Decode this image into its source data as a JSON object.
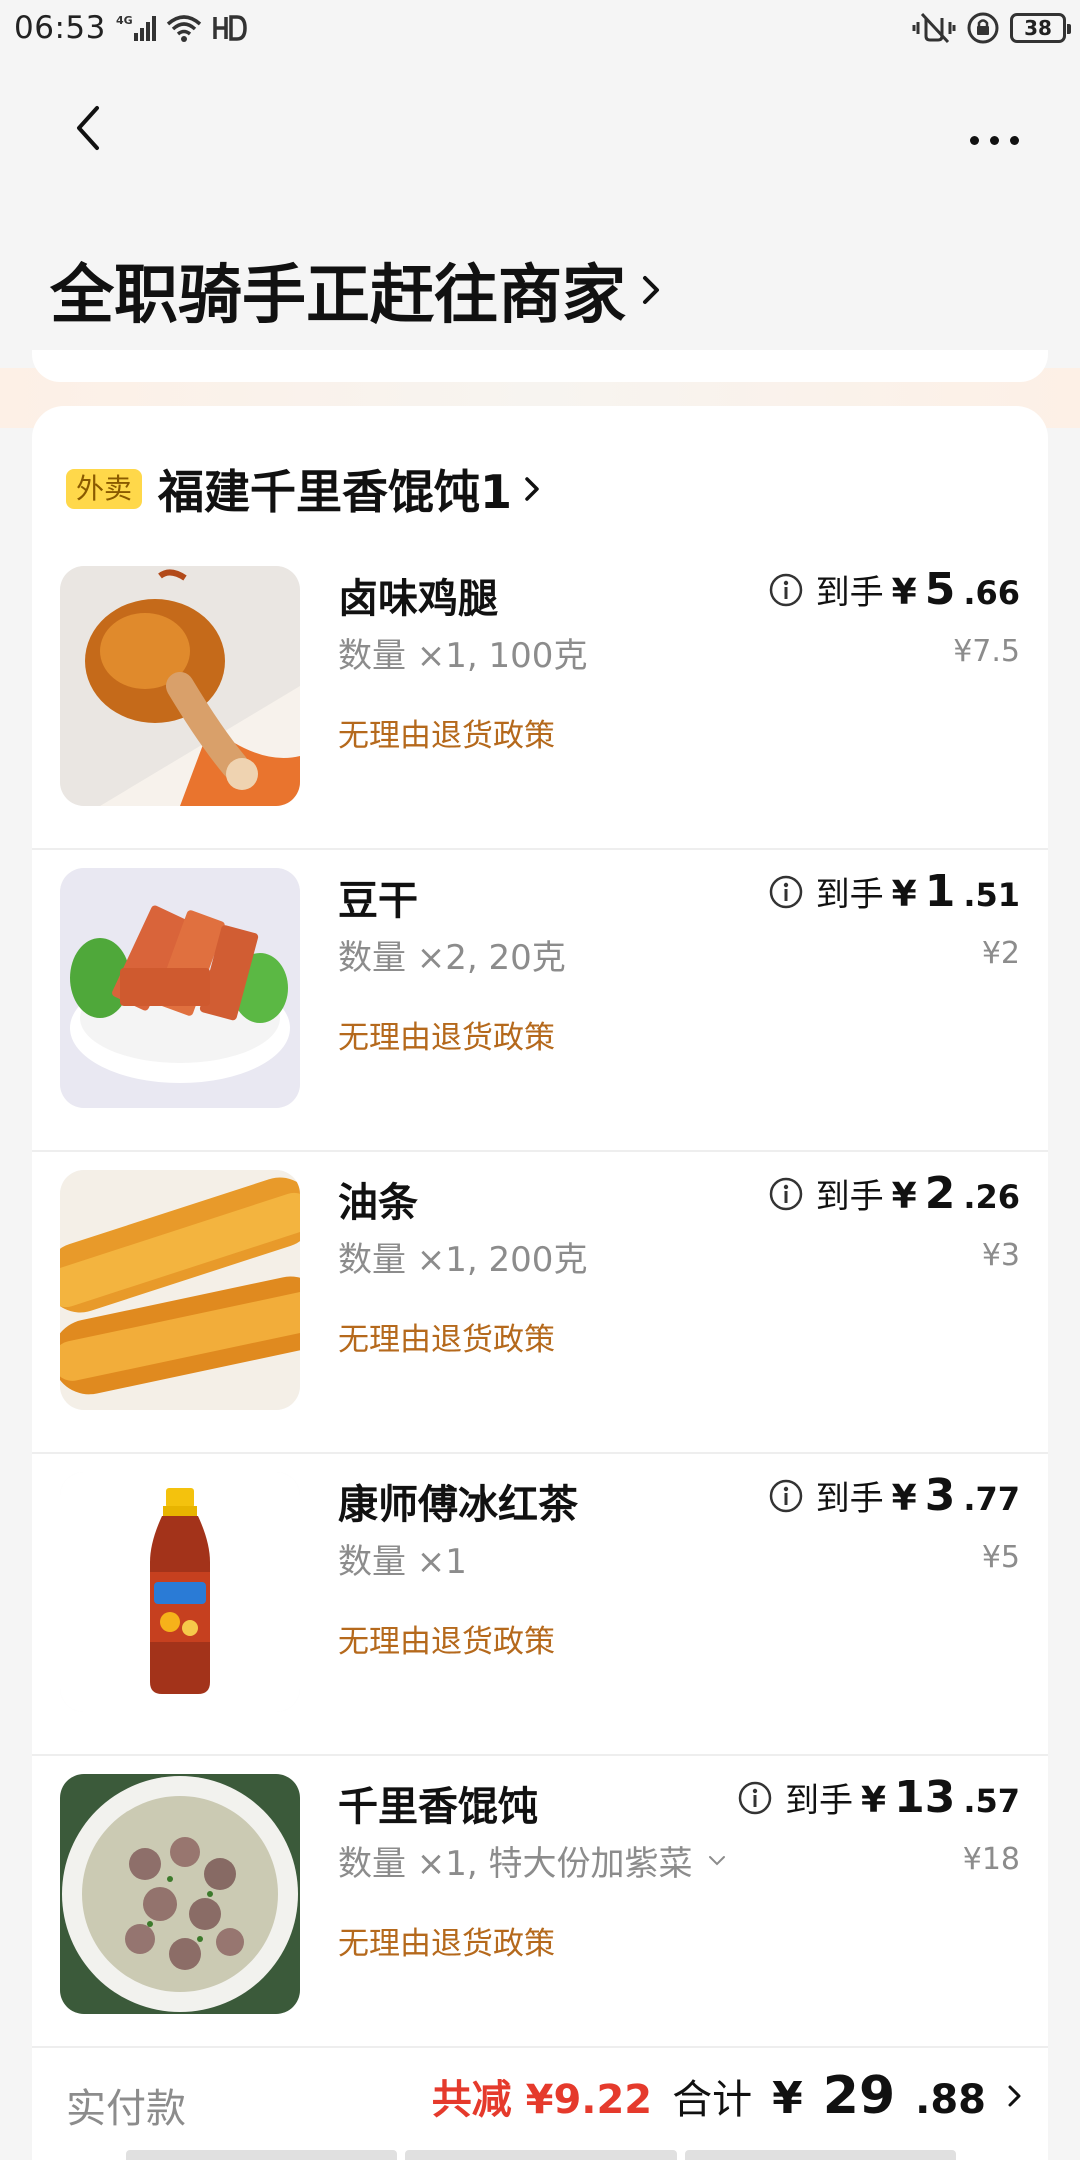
{
  "status_bar": {
    "time": "06:53",
    "network": "4G",
    "hd": "HD",
    "battery": "38"
  },
  "header": {
    "title": "全职骑手正赶往商家"
  },
  "store": {
    "tag": "外卖",
    "name": "福建千里香馄饨1"
  },
  "items": [
    {
      "name": "卤味鸡腿",
      "qty": "数量 ×1, 100克",
      "policy": "无理由退货政策",
      "price_prefix": "到手",
      "price_yen": "¥",
      "price_int": "5",
      "price_dec": ".66",
      "orig_price": "¥7.5",
      "image": "chicken-leg"
    },
    {
      "name": "豆干",
      "qty": "数量 ×2, 20克",
      "policy": "无理由退货政策",
      "price_prefix": "到手",
      "price_yen": "¥",
      "price_int": "1",
      "price_dec": ".51",
      "orig_price": "¥2",
      "image": "dried-tofu"
    },
    {
      "name": "油条",
      "qty": "数量 ×1, 200克",
      "policy": "无理由退货政策",
      "price_prefix": "到手",
      "price_yen": "¥",
      "price_int": "2",
      "price_dec": ".26",
      "orig_price": "¥3",
      "image": "fried-dough"
    },
    {
      "name": "康师傅冰红茶",
      "qty": "数量 ×1",
      "policy": "无理由退货政策",
      "price_prefix": "到手",
      "price_yen": "¥",
      "price_int": "3",
      "price_dec": ".77",
      "orig_price": "¥5",
      "image": "iced-tea-bottle"
    },
    {
      "name": "千里香馄饨",
      "qty": "数量 ×1, 特大份加紫菜",
      "policy": "无理由退货政策",
      "price_prefix": "到手",
      "price_yen": "¥",
      "price_int": "13",
      "price_dec": ".57",
      "orig_price": "¥18",
      "image": "wonton-soup",
      "has_dropdown": true
    }
  ],
  "totals": {
    "label": "实付款",
    "discount": "共减 ¥9.22",
    "total_label": "合计",
    "total_yen": "¥",
    "total_int": "29",
    "total_dec": ".88"
  },
  "colors": {
    "accent_policy": "#b5691c",
    "discount_red": "#e53a2c",
    "store_tag_bg": "#ffd84a"
  }
}
